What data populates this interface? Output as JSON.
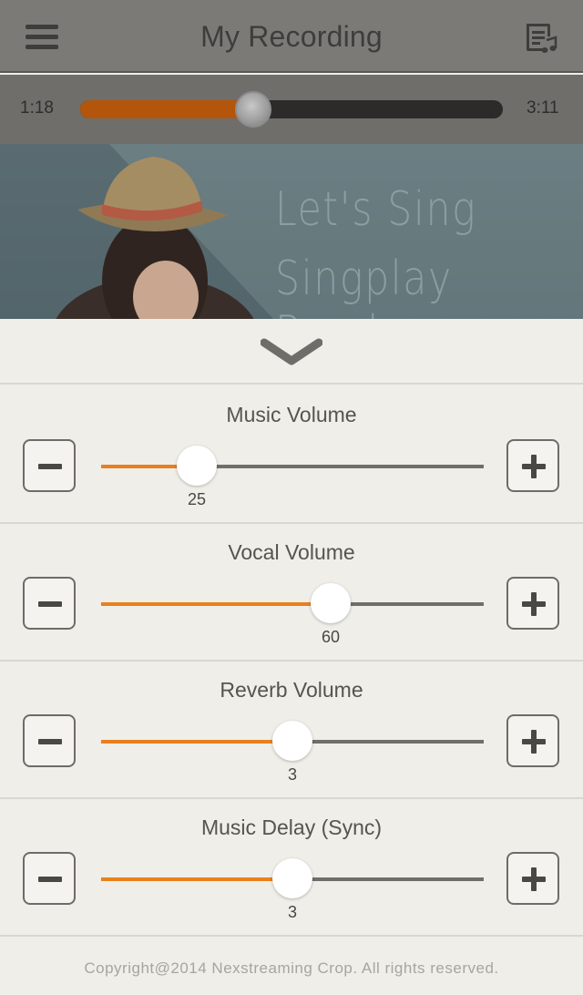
{
  "header": {
    "title": "My Recording",
    "menu_icon": "hamburger-menu-icon",
    "playlist_icon": "music-list-icon"
  },
  "player": {
    "current_time": "1:18",
    "total_time": "3:11",
    "progress": 0.41
  },
  "banner": {
    "line1": "Let's Sing",
    "line2": "Singplay Band"
  },
  "sheet": {
    "collapse_icon": "chevron-down-icon",
    "controls": [
      {
        "title": "Music Volume",
        "value": "25",
        "fraction": 0.25
      },
      {
        "title": "Vocal Volume",
        "value": "60",
        "fraction": 0.6
      },
      {
        "title": "Reverb Volume",
        "value": "3",
        "fraction": 0.5
      },
      {
        "title": "Music Delay (Sync)",
        "value": "3",
        "fraction": 0.5
      }
    ]
  },
  "footer": {
    "copyright": "Copyright@2014 Nexstreaming Crop. All rights reserved."
  },
  "colors": {
    "accent": "#e8801e",
    "progress": "#b3560c",
    "header_bg": "#7c7a76"
  }
}
